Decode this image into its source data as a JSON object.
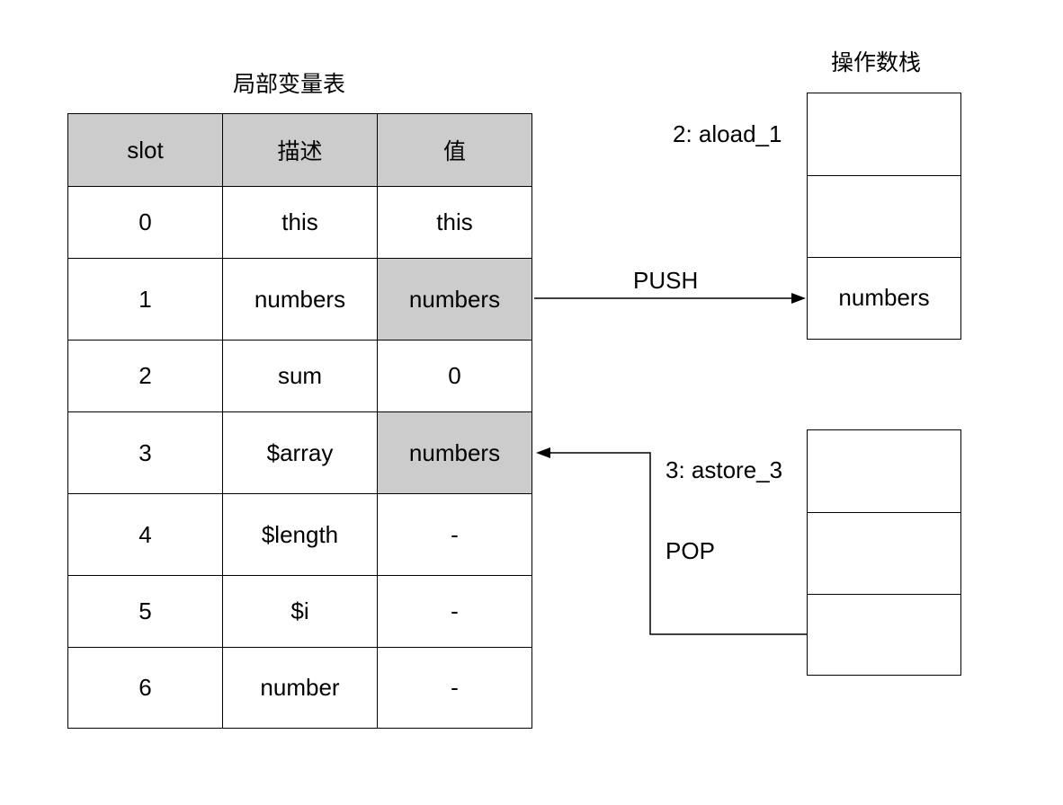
{
  "local_variable_table": {
    "title": "局部变量表",
    "headers": [
      "slot",
      "描述",
      "值"
    ],
    "rows": [
      {
        "slot": "0",
        "desc": "this",
        "value": "this",
        "highlight": false
      },
      {
        "slot": "1",
        "desc": "numbers",
        "value": "numbers",
        "highlight": true
      },
      {
        "slot": "2",
        "desc": "sum",
        "value": "0",
        "highlight": false
      },
      {
        "slot": "3",
        "desc": "$array",
        "value": "numbers",
        "highlight": true
      },
      {
        "slot": "4",
        "desc": "$length",
        "value": "-",
        "highlight": false
      },
      {
        "slot": "5",
        "desc": "$i",
        "value": "-",
        "highlight": false
      },
      {
        "slot": "6",
        "desc": "number",
        "value": "-",
        "highlight": false
      }
    ],
    "header_color": "#cccccc",
    "highlight_color": "#cccccc"
  },
  "operand_stack": {
    "title": "操作数栈",
    "before": {
      "instruction": "2: aload_1",
      "cells": [
        "",
        "",
        "numbers"
      ]
    },
    "after": {
      "instruction": "3: astore_3",
      "cells": [
        "",
        "",
        ""
      ]
    }
  },
  "arrows": {
    "push_label": "PUSH",
    "pop_label": "POP"
  }
}
